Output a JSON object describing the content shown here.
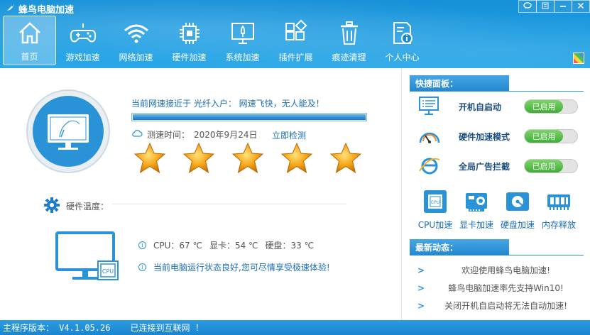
{
  "app": {
    "title": "蜂鸟电脑加速"
  },
  "window_controls": [
    {
      "name": "feedback-button",
      "icon": "chat-bubble-icon"
    },
    {
      "name": "menu-button",
      "icon": "list-icon"
    },
    {
      "name": "minimize-button",
      "icon": "minimize-icon"
    },
    {
      "name": "close-button",
      "icon": "close-icon"
    }
  ],
  "nav": {
    "items": [
      {
        "label": "首页",
        "icon": "home-icon",
        "active": true
      },
      {
        "label": "游戏加速",
        "icon": "gamepad-icon"
      },
      {
        "label": "网络加速",
        "icon": "wifi-icon"
      },
      {
        "label": "硬件加速",
        "icon": "chip-icon"
      },
      {
        "label": "系统加速",
        "icon": "monitor-rocket-icon"
      },
      {
        "label": "插件扩展",
        "icon": "plugin-grid-icon"
      },
      {
        "label": "痕迹清理",
        "icon": "trash-icon"
      },
      {
        "label": "个人中心",
        "icon": "user-document-icon"
      }
    ]
  },
  "speed": {
    "headline": "当前网速接近于 光纤入户： 网速飞快，无人能及！",
    "progress": 1.0,
    "test_time_label": "测速时间：",
    "test_time_value": "2020年9月24日",
    "retest_link": "立即检测",
    "rating_stars": 5
  },
  "hardware": {
    "temp_label": "硬件温度：",
    "cpu": "CPU：67 ℃",
    "gpu": "显卡：54 ℃",
    "disk": "硬盘：33 ℃",
    "status": "当前电脑运行状态良好,您可尽情享受极速体验!",
    "chip_label": "CPU"
  },
  "quick_panel": {
    "title": "快捷面板：",
    "items": [
      {
        "label": "开机自启动",
        "icon": "startup-screen-icon",
        "toggle": "已启用"
      },
      {
        "label": "硬件加速模式",
        "icon": "speedometer-icon",
        "toggle": "已启用"
      },
      {
        "label": "全局广告拦截",
        "icon": "ie-icon",
        "toggle": "已启用"
      }
    ]
  },
  "tools": [
    {
      "label": "CPU加速",
      "icon": "cpu-icon",
      "chip": "CPU"
    },
    {
      "label": "显卡加速",
      "icon": "gpu-card-icon"
    },
    {
      "label": "硬盘加速",
      "icon": "hard-disk-icon"
    },
    {
      "label": "内存释放",
      "icon": "memory-icon"
    }
  ],
  "news": {
    "title": "最新动态：",
    "items": [
      "欢迎使用蜂鸟电脑加速!",
      "蜂鸟电脑加速率先支持Win10!",
      "关闭开机自启动将无法自动加速!"
    ]
  },
  "statusbar": {
    "version": "主程序版本： V4.1.05.26",
    "connection": "已连接到互联网 ！"
  },
  "colors": {
    "primary": "#1a8ad6",
    "accent": "#2a93d8",
    "toggle_on": "#4cb83e",
    "star": "#f5a516"
  }
}
